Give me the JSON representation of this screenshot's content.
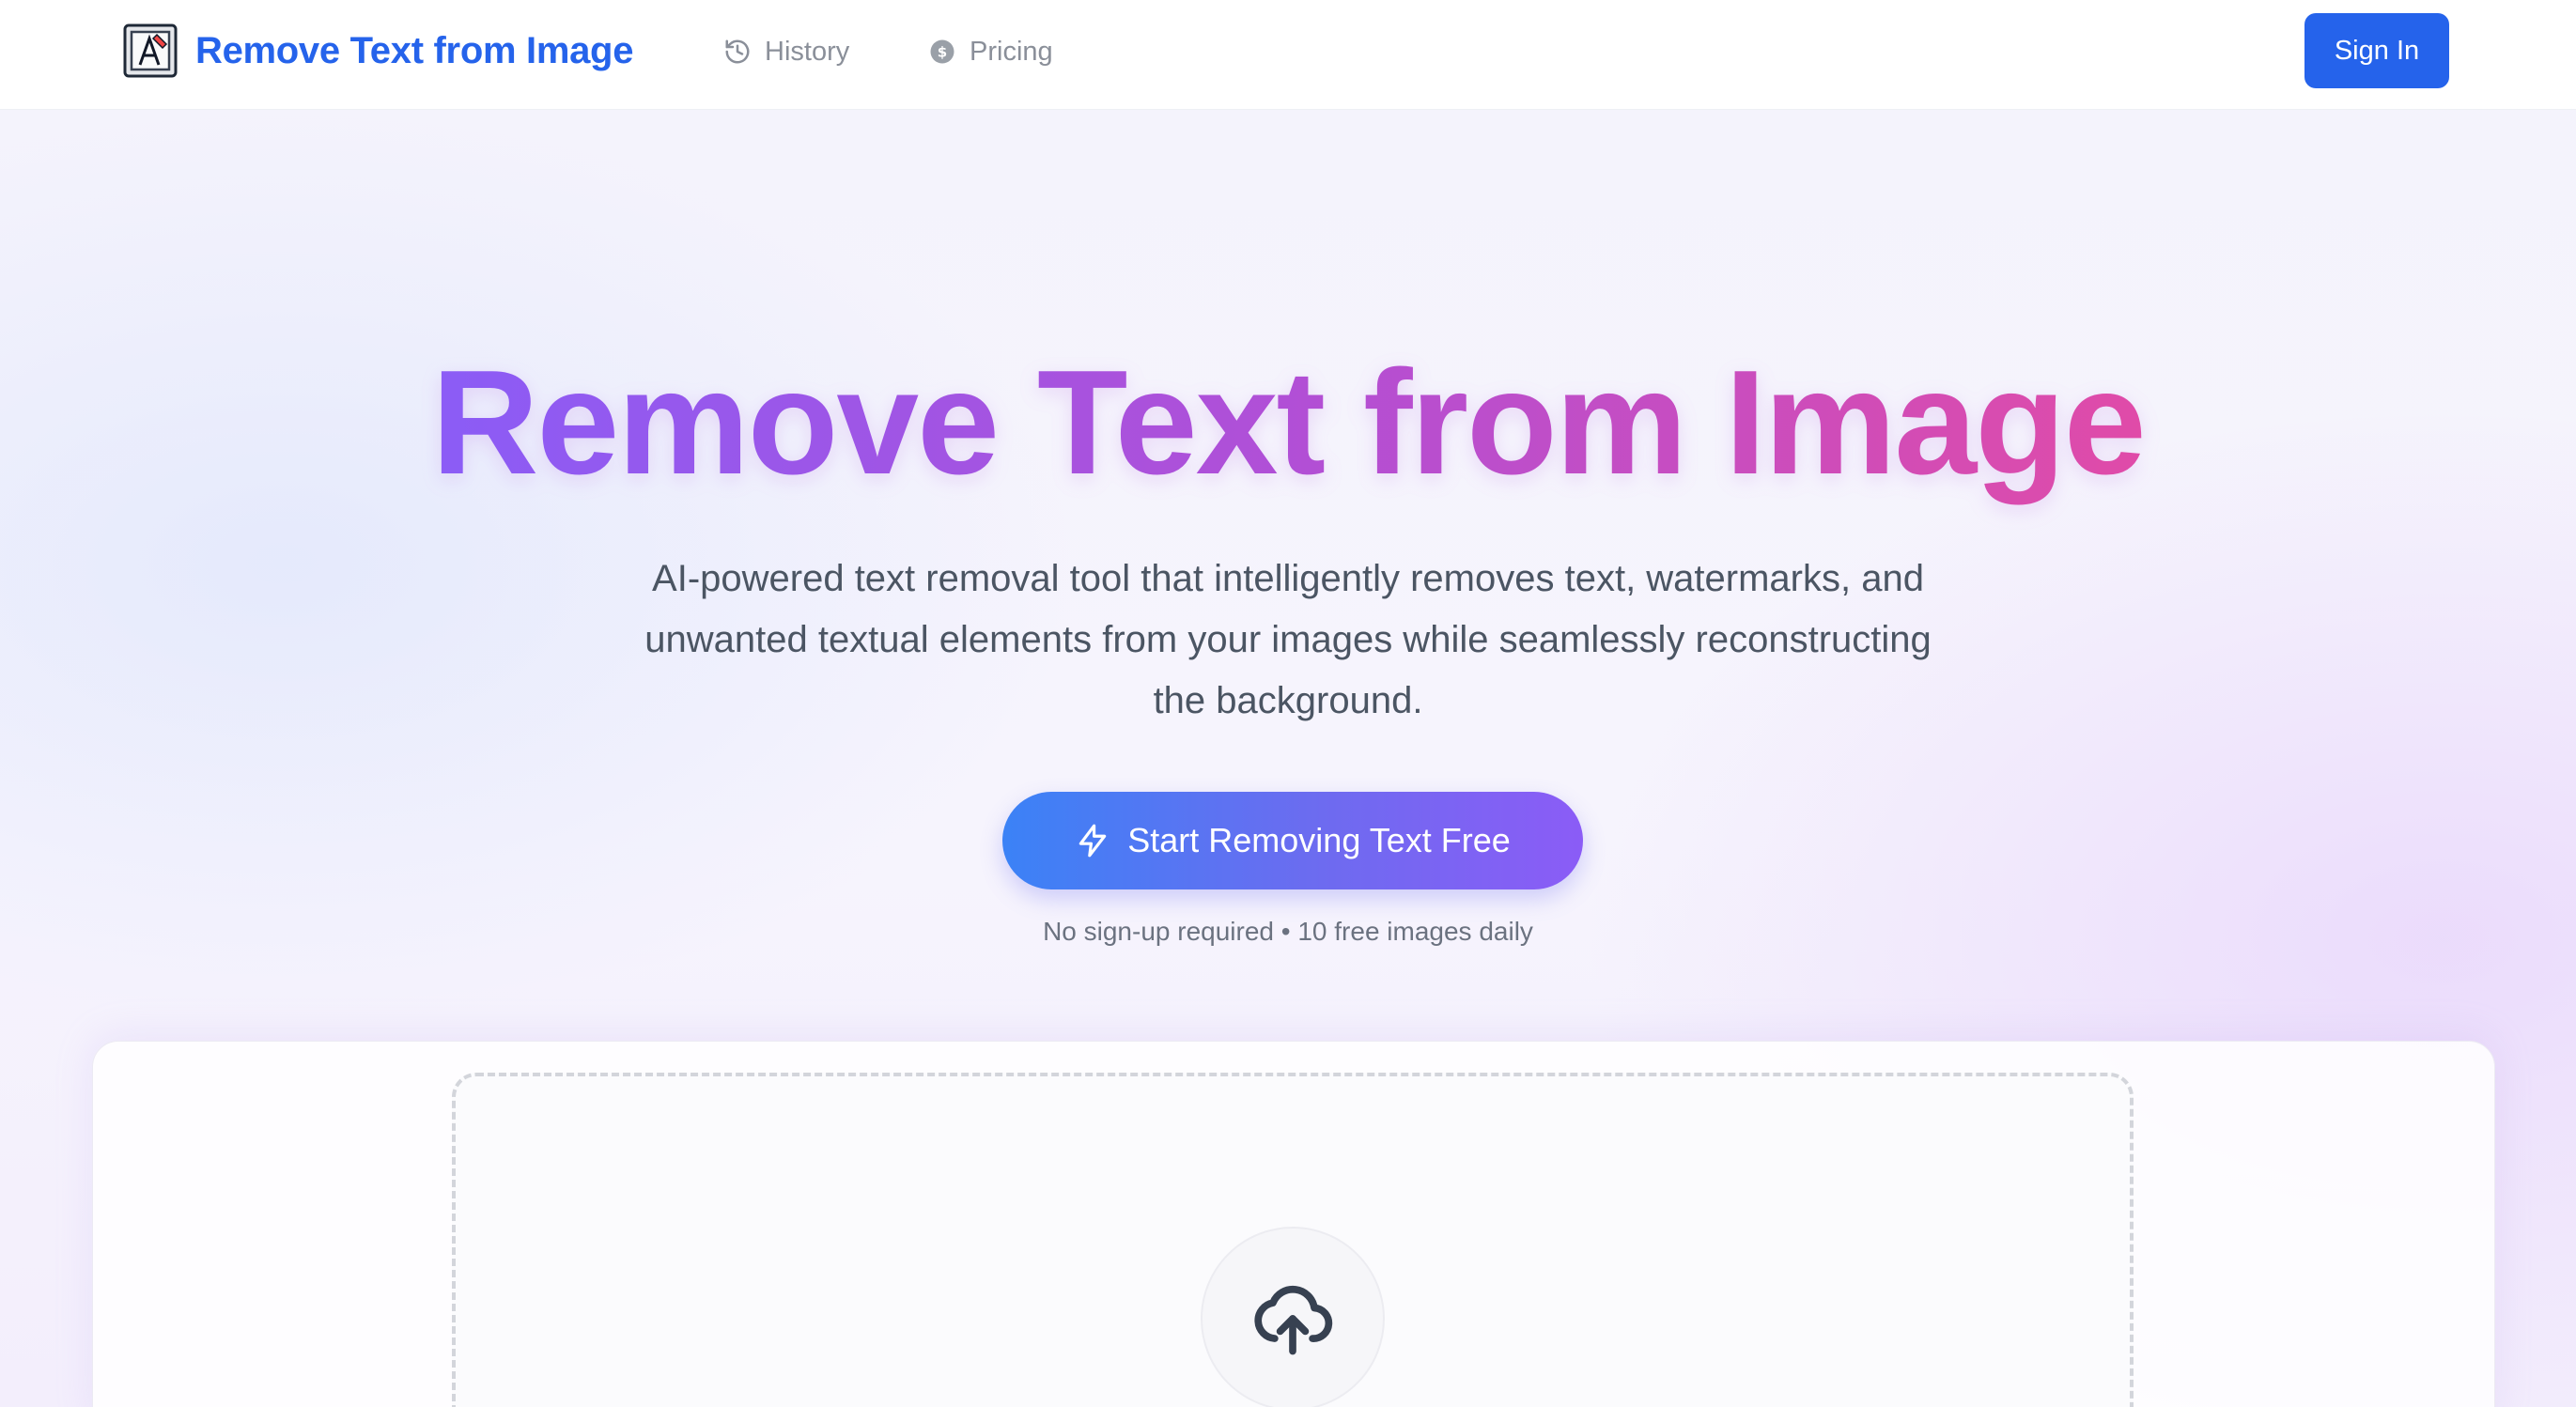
{
  "header": {
    "brand": "Remove Text from Image",
    "nav": [
      {
        "label": "History",
        "icon": "history-icon"
      },
      {
        "label": "Pricing",
        "icon": "coin-icon"
      }
    ],
    "sign_in_label": "Sign In"
  },
  "hero": {
    "title": "Remove Text from Image",
    "subtitle_lines": [
      "AI-powered text removal tool that intelligently removes text, watermarks, and",
      "unwanted textual elements from your images while seamlessly reconstructing",
      "the background."
    ],
    "cta_label": "Start Removing Text Free",
    "cta_icon": "lightning-icon",
    "cta_note": "No sign-up required • 10 free images daily"
  },
  "upload": {
    "icon": "cloud-upload-icon"
  },
  "colors": {
    "brand_blue": "#2563eb",
    "gradient_start": "#8b5cf6",
    "gradient_end": "#e04ba8"
  }
}
